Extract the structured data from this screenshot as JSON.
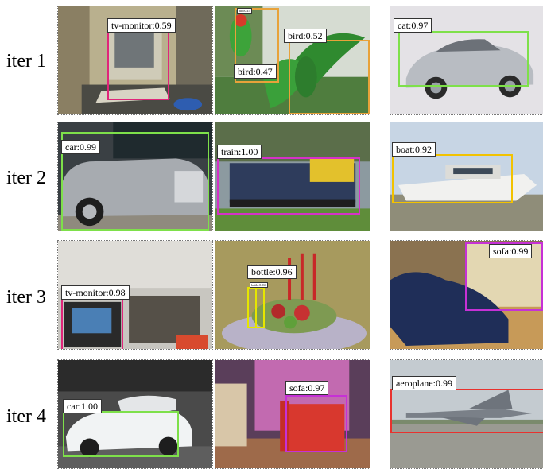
{
  "rows": [
    {
      "label": "iter 1"
    },
    {
      "label": "iter 2"
    },
    {
      "label": "iter 3"
    },
    {
      "label": "iter 4"
    }
  ],
  "cells": [
    {
      "subject": "computer monitor and keyboard on desk",
      "detections": [
        {
          "label": "tv-monitor:0.59",
          "color": "#e0267a"
        }
      ]
    },
    {
      "subject": "green parrot in flight",
      "detections": [
        {
          "label": "bird:0.47",
          "color": "#e8a23a"
        },
        {
          "label": "bird:0.52",
          "color": "#e8a23a"
        },
        {
          "label": "bird:0.47",
          "color": "#e8a23a"
        }
      ]
    },
    {
      "subject": "silver sports car",
      "detections": [
        {
          "label": "cat:0.97",
          "color": "#7ee04a"
        }
      ]
    },
    {
      "subject": "silver luxury car at showroom",
      "detections": [
        {
          "label": "car:0.99",
          "color": "#7ee04a"
        }
      ]
    },
    {
      "subject": "freight locomotive",
      "detections": [
        {
          "label": "train:1.00",
          "color": "#d531c8"
        }
      ]
    },
    {
      "subject": "white motor boat on shore",
      "detections": [
        {
          "label": "boat:0.92",
          "color": "#f2c200"
        }
      ]
    },
    {
      "subject": "television on stand in room",
      "detections": [
        {
          "label": "tv-monitor:0.98",
          "color": "#e0267a"
        }
      ]
    },
    {
      "subject": "fruit bowl with candles",
      "detections": [
        {
          "label": "bottle:0.96",
          "color": "#e6e600"
        },
        {
          "label": "bottle:0.966",
          "color": "#e6e600"
        }
      ]
    },
    {
      "subject": "person sleeping near sofa",
      "detections": [
        {
          "label": "sofa:0.99",
          "color": "#c631d6"
        }
      ]
    },
    {
      "subject": "white concept car at auto show",
      "detections": [
        {
          "label": "car:1.00",
          "color": "#7ee04a"
        }
      ]
    },
    {
      "subject": "red armchair in lobby",
      "detections": [
        {
          "label": "sofa:0.97",
          "color": "#c631d6"
        }
      ]
    },
    {
      "subject": "fighter jet on runway",
      "detections": [
        {
          "label": "aeroplane:0.99",
          "color": "#e8322e"
        }
      ]
    }
  ]
}
